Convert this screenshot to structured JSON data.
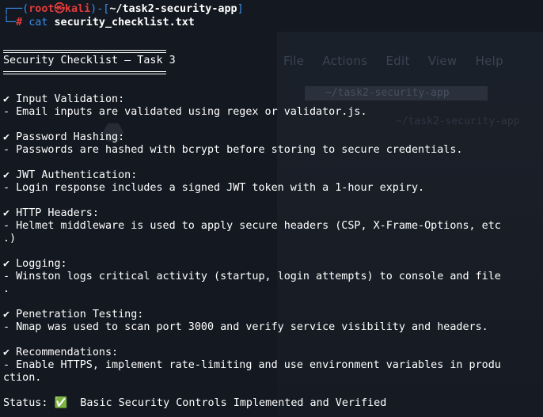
{
  "prompt": {
    "frame_top": "┌──(",
    "user": "root㉿kali",
    "frame_mid": ")-[",
    "path": "~/task2-security-app",
    "frame_end": "]",
    "frame_bottom": "└─",
    "hash": "#",
    "command_name": "cat",
    "command_arg": "security_checklist.txt"
  },
  "doc": {
    "title": "Security Checklist – Task 3",
    "sections": [
      {
        "heading": "✔ Input Validation:",
        "lines": [
          "- Email inputs are validated using regex or validator.js."
        ]
      },
      {
        "heading": "✔ Password Hashing:",
        "lines": [
          "- Passwords are hashed with bcrypt before storing to secure credentials."
        ]
      },
      {
        "heading": "✔ JWT Authentication:",
        "lines": [
          "- Login response includes a signed JWT token with a 1-hour expiry."
        ]
      },
      {
        "heading": "✔ HTTP Headers:",
        "lines": [
          "- Helmet middleware is used to apply secure headers (CSP, X-Frame-Options, etc",
          ".)"
        ]
      },
      {
        "heading": "✔ Logging:",
        "lines": [
          "- Winston logs critical activity (startup, login attempts) to console and file",
          "."
        ]
      },
      {
        "heading": "✔ Penetration Testing:",
        "lines": [
          "- Nmap was used to scan port 3000 and verify service visibility and headers."
        ]
      },
      {
        "heading": "✔ Recommendations:",
        "lines": [
          "- Enable HTTPS, implement rate-limiting and use environment variables in produ",
          "ction."
        ]
      }
    ],
    "status": "Status: ✅  Basic Security Controls Implemented and Verified"
  },
  "background_window": {
    "menu": [
      "File",
      "Actions",
      "Edit",
      "View",
      "Help"
    ],
    "tab": "~/task2-security-app",
    "path": "~/task2-security-app"
  }
}
